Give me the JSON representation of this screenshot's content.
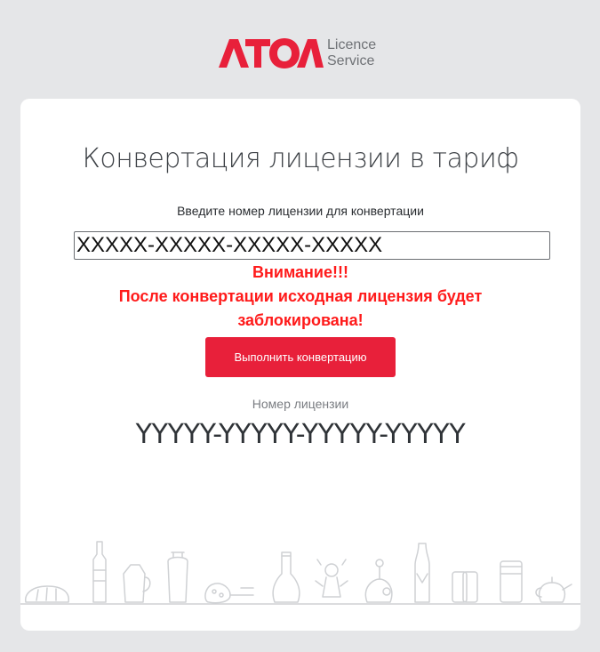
{
  "header": {
    "logo_text_line1": "Licence",
    "logo_text_line2": "Service",
    "brand_color": "#e8203a"
  },
  "card": {
    "title": "Конвертация лицензии в тариф",
    "subtitle": "Введите номер лицензии для конвертации",
    "input": {
      "value": "XXXXX-XXXXX-XXXXX-XXXXX",
      "placeholder": ""
    },
    "warning": {
      "heading": "Внимание!!!",
      "body": "После конвертации исходная лицензия будет заблокирована!",
      "color": "#ff1a1a"
    },
    "convert_button_label": "Выполнить конвертацию",
    "result_label": "Номер лицензии",
    "result_value": "YYYYY-YYYYY-YYYYY-YYYYY"
  },
  "icons": {
    "logo": "atol-logo-icon",
    "illustration": "grocery-items-illustration-icon"
  }
}
